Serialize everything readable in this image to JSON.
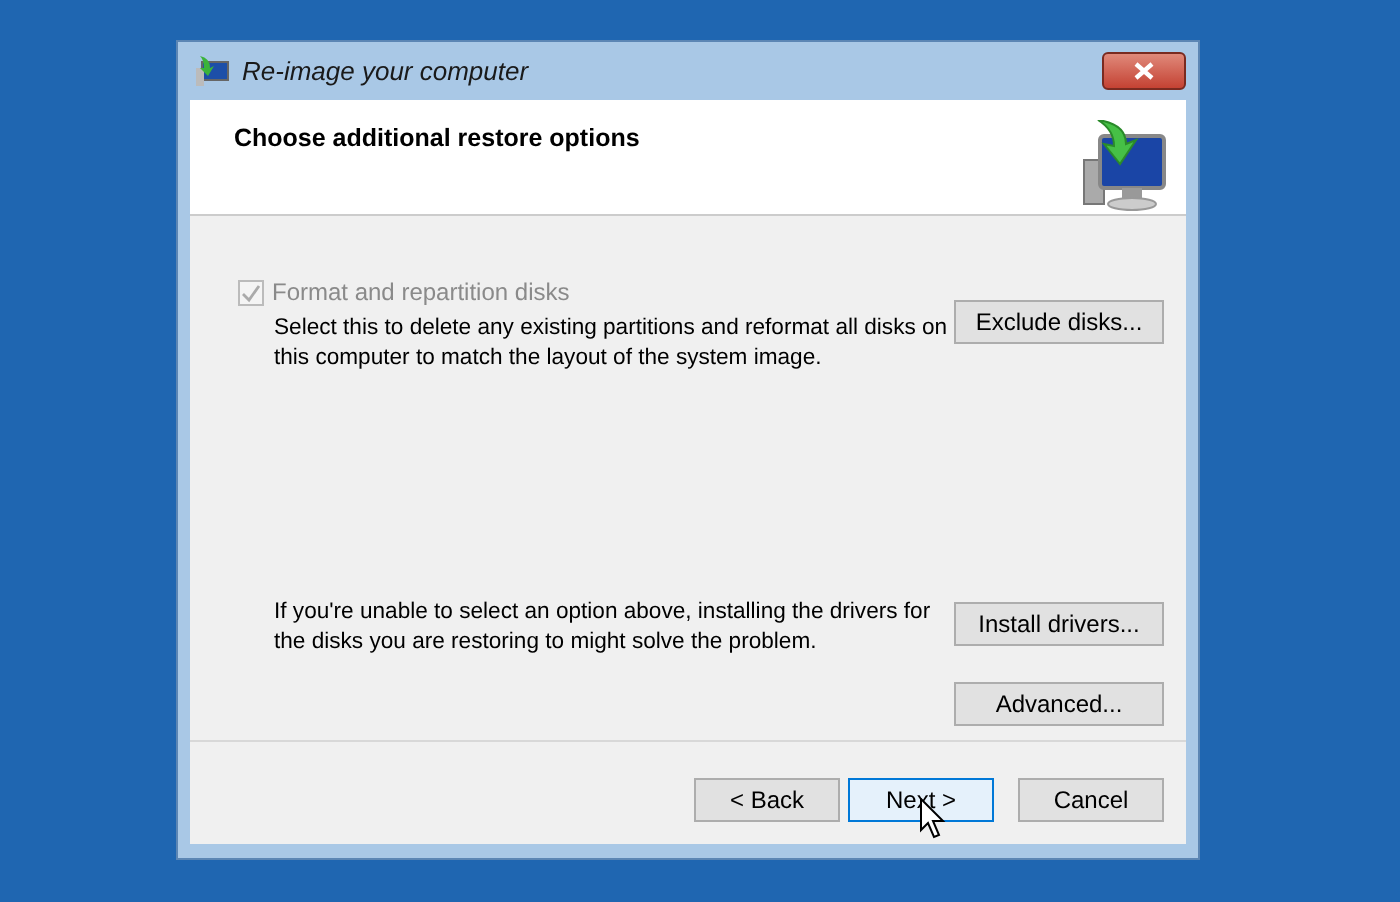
{
  "window": {
    "title": "Re-image your computer"
  },
  "header": {
    "title": "Choose additional restore options"
  },
  "options": [
    {
      "kind": "checkbox",
      "label": "Format and repartition disks",
      "checked": true,
      "disabled": true,
      "description": "Select this to delete any existing partitions and reformat all disks on this computer to match the layout of the system image.",
      "buttons": [
        {
          "label": "Exclude disks..."
        }
      ]
    },
    {
      "kind": "text",
      "description": "If you're unable to select an option above, installing the drivers for the disks you are restoring to might solve the problem.",
      "buttons": [
        {
          "label": "Install drivers..."
        },
        {
          "label": "Advanced..."
        }
      ]
    }
  ],
  "footer_buttons": [
    {
      "label": "< Back",
      "focused": false
    },
    {
      "label": "Next >",
      "focused": true
    },
    {
      "label": "Cancel",
      "focused": false
    }
  ]
}
